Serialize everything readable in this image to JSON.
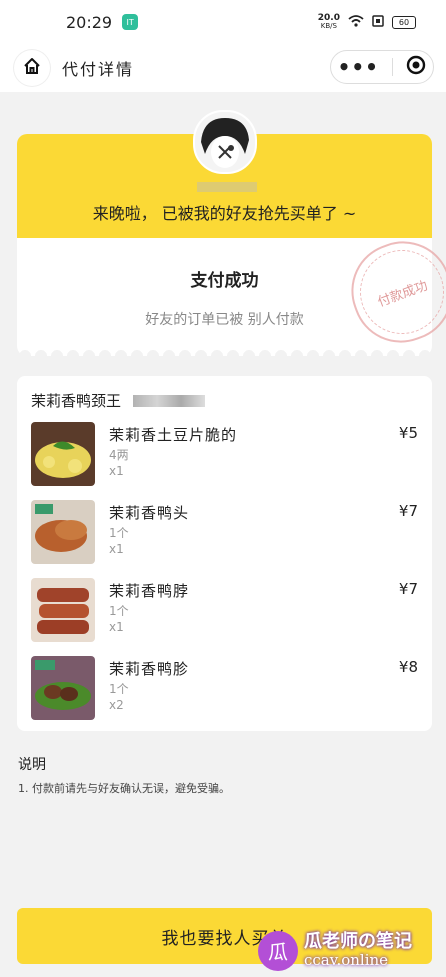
{
  "status_bar": {
    "time": "20:29",
    "app_badge": "IT",
    "net_speed_top": "20.0",
    "net_speed_unit": "KB/S",
    "battery": "60"
  },
  "nav": {
    "title": "代付详情"
  },
  "pay_card": {
    "message": "来晚啦， 已被我的好友抢先买单了 ~",
    "status": "支付成功",
    "sub": "好友的订单已被 别人付款",
    "stamp": "付款成功"
  },
  "order": {
    "shop_name": "茉莉香鸭颈王",
    "items": [
      {
        "name": "茉莉香土豆片脆的",
        "spec": "4两",
        "qty": "x1",
        "price": "¥5"
      },
      {
        "name": "茉莉香鸭头",
        "spec": "1个",
        "qty": "x1",
        "price": "¥7"
      },
      {
        "name": "茉莉香鸭脖",
        "spec": "1个",
        "qty": "x1",
        "price": "¥7"
      },
      {
        "name": "茉莉香鸭胗",
        "spec": "1个",
        "qty": "x2",
        "price": "¥8"
      }
    ]
  },
  "notes": {
    "title": "说明",
    "text": "1. 付款前请先与好友确认无误，避免受骗。"
  },
  "bottom_button": "我也要找人买单",
  "watermark": {
    "logo": "瓜",
    "line1": "瓜老师の笔记",
    "line2": "ccav.online"
  }
}
